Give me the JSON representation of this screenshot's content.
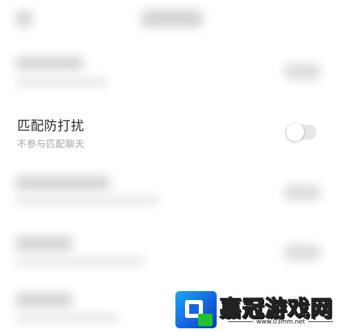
{
  "setting": {
    "title": "匹配防打扰",
    "subtitle": "不参与匹配聊天",
    "toggle_on": false
  },
  "watermark": {
    "name": "嘉冠游戏网",
    "url": "www.03mm.net"
  }
}
